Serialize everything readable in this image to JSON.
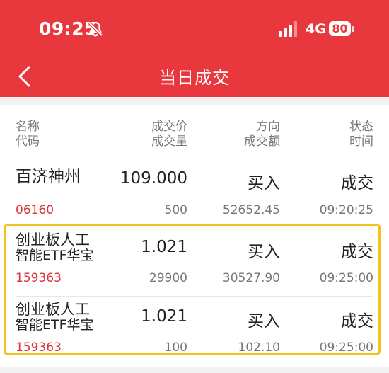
{
  "status_bar": {
    "time": "09:25",
    "network": "4G",
    "battery": "80"
  },
  "nav": {
    "title": "当日成交"
  },
  "columns": {
    "name": [
      "名称",
      "代码"
    ],
    "price": [
      "成交价",
      "成交量"
    ],
    "direction": [
      "方向",
      "成交额"
    ],
    "status": [
      "状态",
      "时间"
    ]
  },
  "trades": [
    {
      "name_line1": "百济神州",
      "name_line2": "",
      "code": "06160",
      "price": "109.000",
      "volume": "500",
      "direction": "买入",
      "amount": "52652.45",
      "status": "成交",
      "time": "09:20:25"
    },
    {
      "name_line1": "创业板人工",
      "name_line2": "智能ETF华宝",
      "code": "159363",
      "price": "1.021",
      "volume": "29900",
      "direction": "买入",
      "amount": "30527.90",
      "status": "成交",
      "time": "09:25:00"
    },
    {
      "name_line1": "创业板人工",
      "name_line2": "智能ETF华宝",
      "code": "159363",
      "price": "1.021",
      "volume": "100",
      "direction": "买入",
      "amount": "102.10",
      "status": "成交",
      "time": "09:25:00"
    }
  ],
  "colors": {
    "header": "#e8383d",
    "code": "#d9343a",
    "highlight": "#f3c21c"
  },
  "icons": {
    "back": "chevron-left-icon",
    "mute": "bell-slash-icon",
    "signal": "signal-icon",
    "battery": "battery-icon"
  }
}
